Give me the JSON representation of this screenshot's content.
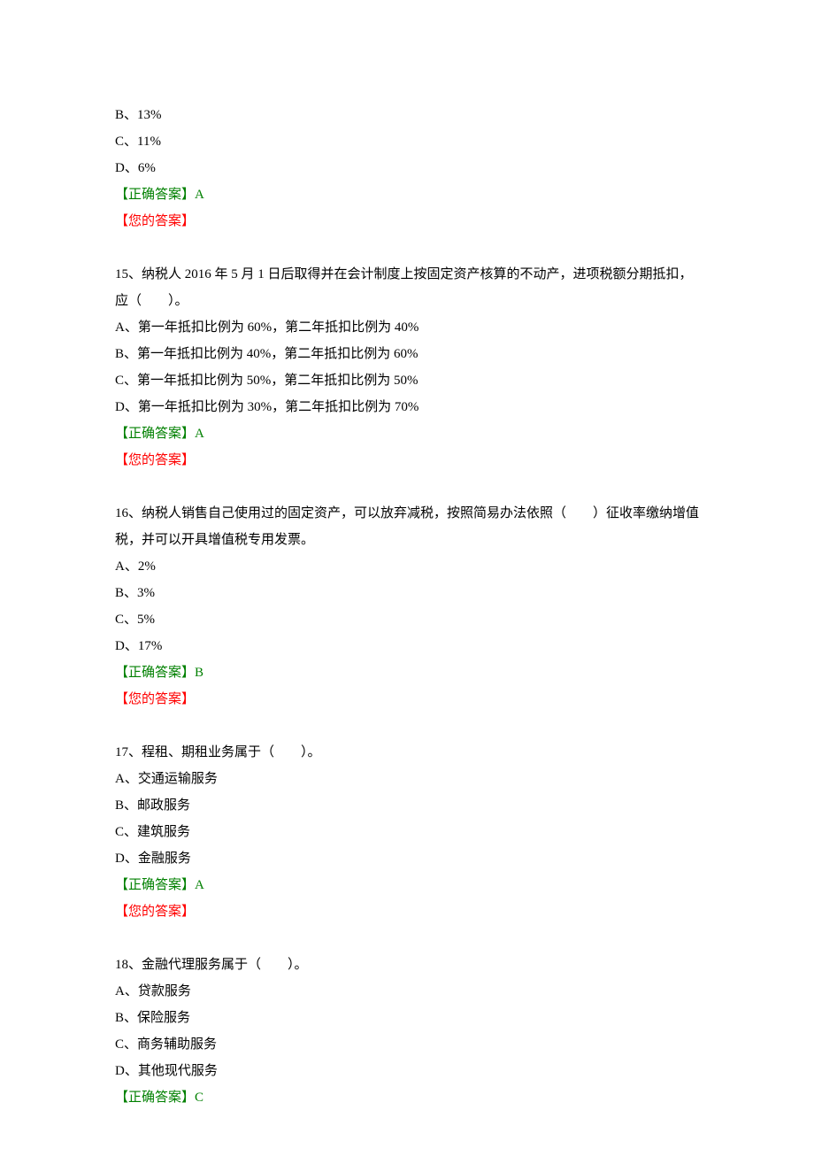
{
  "q14_tail": {
    "options": [
      "B、13%",
      "C、11%",
      "D、6%"
    ],
    "correct_label": "【正确答案】",
    "correct_value": "A",
    "your_label": "【您的答案】"
  },
  "q15": {
    "text": "15、纳税人 2016 年 5 月 1 日后取得并在会计制度上按固定资产核算的不动产，进项税额分期抵扣，应（　　）。",
    "options": [
      "A、第一年抵扣比例为 60%，第二年抵扣比例为 40%",
      "B、第一年抵扣比例为 40%，第二年抵扣比例为 60%",
      "C、第一年抵扣比例为 50%，第二年抵扣比例为 50%",
      "D、第一年抵扣比例为 30%，第二年抵扣比例为 70%"
    ],
    "correct_label": "【正确答案】",
    "correct_value": "A",
    "your_label": "【您的答案】"
  },
  "q16": {
    "text": "16、纳税人销售自己使用过的固定资产，可以放弃减税，按照简易办法依照（　　）征收率缴纳增值税，并可以开具增值税专用发票。",
    "options": [
      "A、2%",
      "B、3%",
      "C、5%",
      "D、17%"
    ],
    "correct_label": "【正确答案】",
    "correct_value": "B",
    "your_label": "【您的答案】"
  },
  "q17": {
    "text": "17、程租、期租业务属于（　　）。",
    "options": [
      "A、交通运输服务",
      "B、邮政服务",
      "C、建筑服务",
      "D、金融服务"
    ],
    "correct_label": "【正确答案】",
    "correct_value": "A",
    "your_label": "【您的答案】"
  },
  "q18": {
    "text": "18、金融代理服务属于（　　）。",
    "options": [
      "A、贷款服务",
      "B、保险服务",
      "C、商务辅助服务",
      "D、其他现代服务"
    ],
    "correct_label": "【正确答案】",
    "correct_value": "C"
  }
}
